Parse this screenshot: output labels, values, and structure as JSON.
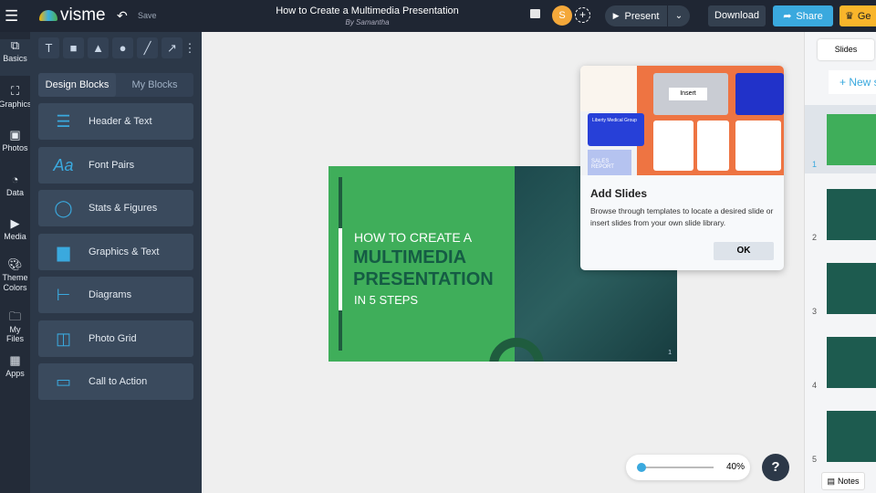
{
  "header": {
    "brand": "visme",
    "save": "Save",
    "title": "How to Create a Multimedia Presentation",
    "author": "By Samantha",
    "avatar": "S",
    "present": "Present",
    "download": "Download",
    "share": "Share",
    "upgrade": "Ge"
  },
  "rail": [
    {
      "label": "Basics"
    },
    {
      "label": "Graphics"
    },
    {
      "label": "Photos"
    },
    {
      "label": "Data"
    },
    {
      "label": "Media"
    },
    {
      "label": "Theme Colors"
    },
    {
      "label": "My Files"
    },
    {
      "label": "Apps"
    }
  ],
  "panel": {
    "tabs": [
      "Design Blocks",
      "My Blocks"
    ],
    "blocks": [
      "Header & Text",
      "Font Pairs",
      "Stats & Figures",
      "Graphics & Text",
      "Diagrams",
      "Photo Grid",
      "Call to Action"
    ]
  },
  "slide": {
    "line1": "HOW TO CREATE A",
    "line2": "MULTIMEDIA",
    "line3": "PRESENTATION",
    "line4": "IN 5 STEPS",
    "page": "1"
  },
  "popup": {
    "title": "Add Slides",
    "body": "Browse through templates to locate a desired slide or insert slides from your own slide library.",
    "ok": "OK",
    "insert": "Insert",
    "tpl1": "Liberty Medical Group",
    "tpl2": "SALES REPORT"
  },
  "slides_panel": {
    "tab": "Slides",
    "new": "+ New s",
    "numbers": [
      "1",
      "2",
      "3",
      "4",
      "5"
    ],
    "notes": "Notes"
  },
  "zoom": {
    "value": "40%",
    "level": 0.05
  },
  "help": "?"
}
